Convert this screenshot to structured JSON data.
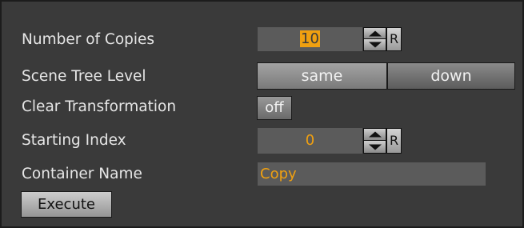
{
  "copies": {
    "label": "Number of Copies",
    "value": "10",
    "reset_label": "R"
  },
  "scene_tree_level": {
    "label": "Scene Tree Level",
    "options": [
      "same",
      "down"
    ],
    "selected": "same"
  },
  "clear_transformation": {
    "label": "Clear Transformation",
    "value": "off"
  },
  "starting_index": {
    "label": "Starting Index",
    "value": "0",
    "reset_label": "R"
  },
  "container_name": {
    "label": "Container Name",
    "value": "Copy"
  },
  "execute_label": "Execute",
  "colors": {
    "panel": "#3a3a3a",
    "field": "#5b5b5b",
    "accent": "#f0a010"
  }
}
